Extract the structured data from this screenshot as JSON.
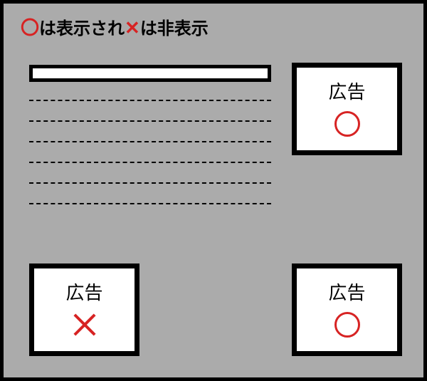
{
  "legend": {
    "circle_symbol": "〇",
    "text1": "は表示され",
    "x_symbol": "✕",
    "text2": "は非表示"
  },
  "ads": {
    "top_right": {
      "label": "広告",
      "status": "circle"
    },
    "bottom_left": {
      "label": "広告",
      "status": "x"
    },
    "bottom_right": {
      "label": "広告",
      "status": "circle"
    }
  },
  "colors": {
    "accent": "#d72323",
    "bg": "#ababab"
  }
}
